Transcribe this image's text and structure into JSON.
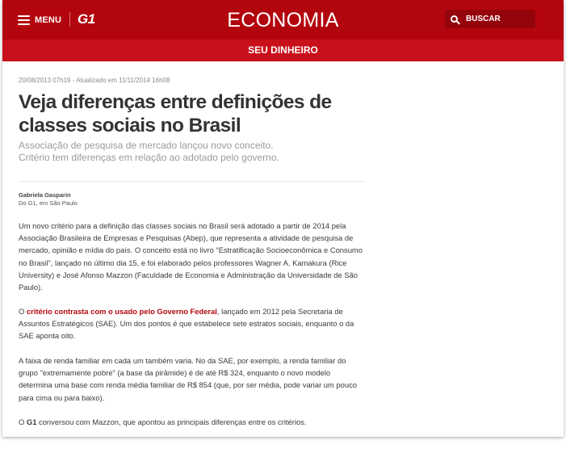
{
  "header": {
    "menu_label": "MENU",
    "logo": "G1",
    "section_title": "ECONOMIA",
    "search_label": "BUSCAR",
    "brand_color": "#b3050d",
    "menu_icon": "hamburger-icon",
    "search_icon": "magnifier-icon"
  },
  "subsection": {
    "label": "SEU DINHEIRO"
  },
  "article": {
    "meta": "20/08/2013 07h19 - Atualizado em 11/11/2014 16h08",
    "headline": "Veja diferenças entre definições de classes sociais no Brasil",
    "subtitle_line1": "Associação de pesquisa de mercado lançou novo conceito.",
    "subtitle_line2": "Critério tem diferenças em relação ao adotado pelo governo.",
    "author": "Gabriela Gasparin",
    "place": "Do G1, em São Paulo",
    "paragraph1": "Um novo critério para a definição das classes sociais no Brasil será adotado a partir de 2014 pela Associação Brasileira de Empresas e Pesquisas (Abep), que representa a atividade de pesquisa de mercado, opinião e mídia do país. O conceito está no livro \"Estratificação Socioeconômica e Consumo no Brasil\", lançado no último dia 15, e foi elaborado pelos professores Wagner A. Kamakura (Rice University) e José Afonso Mazzon (Faculdade de Economia e Administração da Universidade de São Paulo).",
    "paragraph2_prefix": "O ",
    "paragraph2_link": "critério contrasta com o usado pelo Governo Federal",
    "paragraph2_suffix": ", lançado em 2012 pela Secretaria de Assuntos Estratégicos (SAE). Um dos pontos é que estabelece sete estratos sociais, enquanto o da SAE aponta oito.",
    "paragraph3": "A faixa de renda familiar em cada um também varia. No da SAE, por exemplo, a renda familiar do grupo \"extremamente pobre\" (a base da pirâmide) é de até R$ 324, enquanto o novo modelo determina uma base com renda média familiar de R$ 854 (que, por ser média, pode variar um pouco para cima ou para baixo).",
    "paragraph4_prefix": "O ",
    "paragraph4_strong": "G1",
    "paragraph4_suffix": " conversou com Mazzon, que apontou as principais diferenças entre os critérios."
  }
}
